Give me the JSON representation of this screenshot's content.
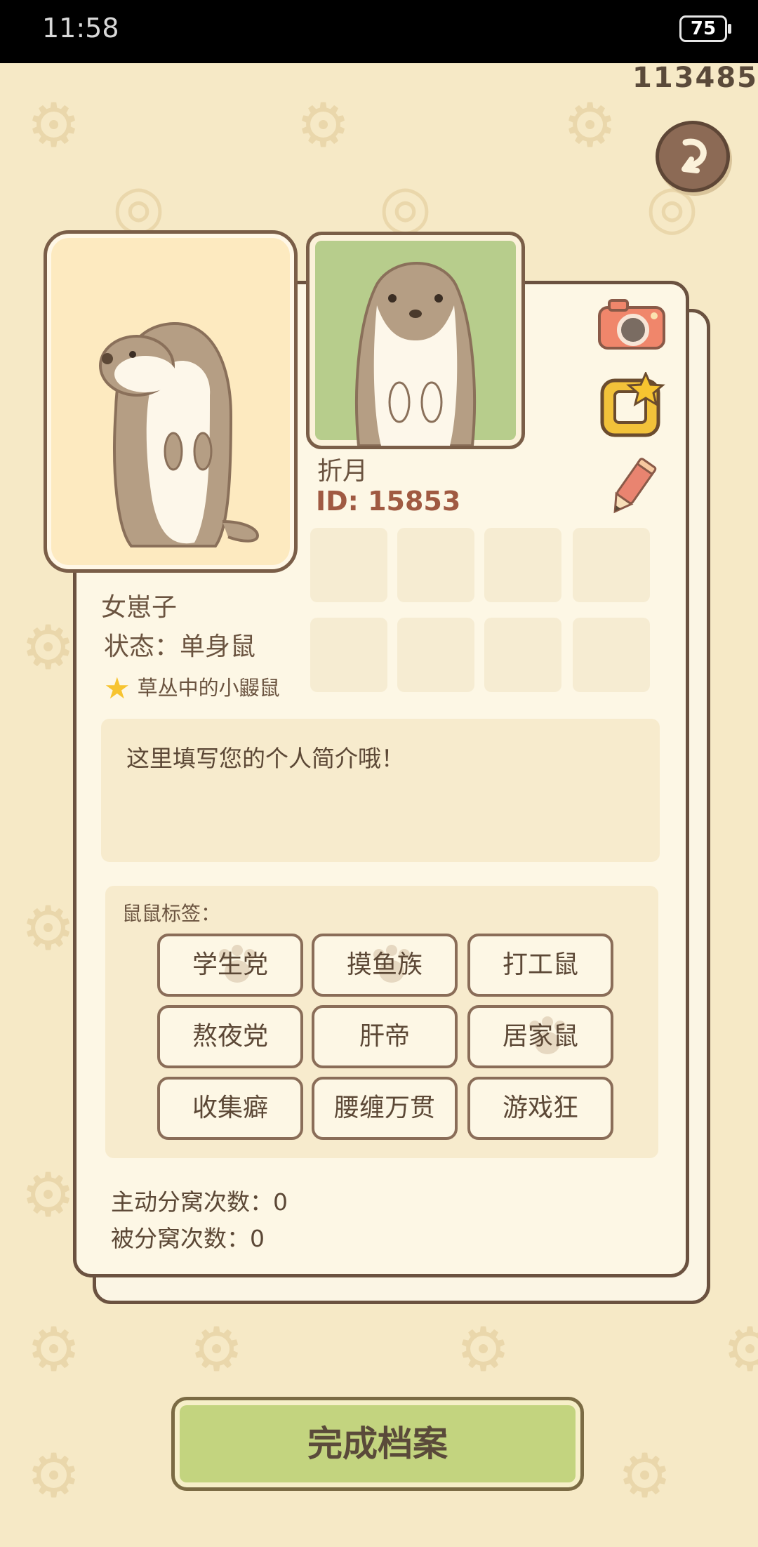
{
  "status_bar": {
    "time": "11:58",
    "battery": "75"
  },
  "header": {
    "counter": "113485"
  },
  "profile": {
    "nickname": "折月",
    "id_label": "ID: 15853",
    "gender": "女崽子",
    "status": "状态：单身鼠",
    "title": "草丛中的小鼹鼠",
    "bio_placeholder": "这里填写您的个人简介哦！"
  },
  "tags": {
    "label": "鼠鼠标签：",
    "items": [
      "学生党",
      "摸鱼族",
      "打工鼠",
      "熬夜党",
      "肝帝",
      "居家鼠",
      "收集癖",
      "腰缠万贯",
      "游戏狂"
    ],
    "selected": [
      "学生党",
      "摸鱼族",
      "居家鼠"
    ]
  },
  "stats": {
    "active_split": "主动分窝次数：0",
    "passive_split": "被分窝次数：0"
  },
  "footer": {
    "finish_label": "完成档案"
  },
  "icons": [
    "back-arrow-icon",
    "camera-icon",
    "frame-star-icon",
    "pencil-icon",
    "star-icon",
    "paw-icon",
    "gear-icon",
    "screw-icon",
    "compass-icon"
  ],
  "colors": {
    "background": "#f6e9c6",
    "card": "#fdf7e5",
    "border": "#6b5240",
    "accent_green": "#c3d47f",
    "id_red": "#a05a42"
  }
}
